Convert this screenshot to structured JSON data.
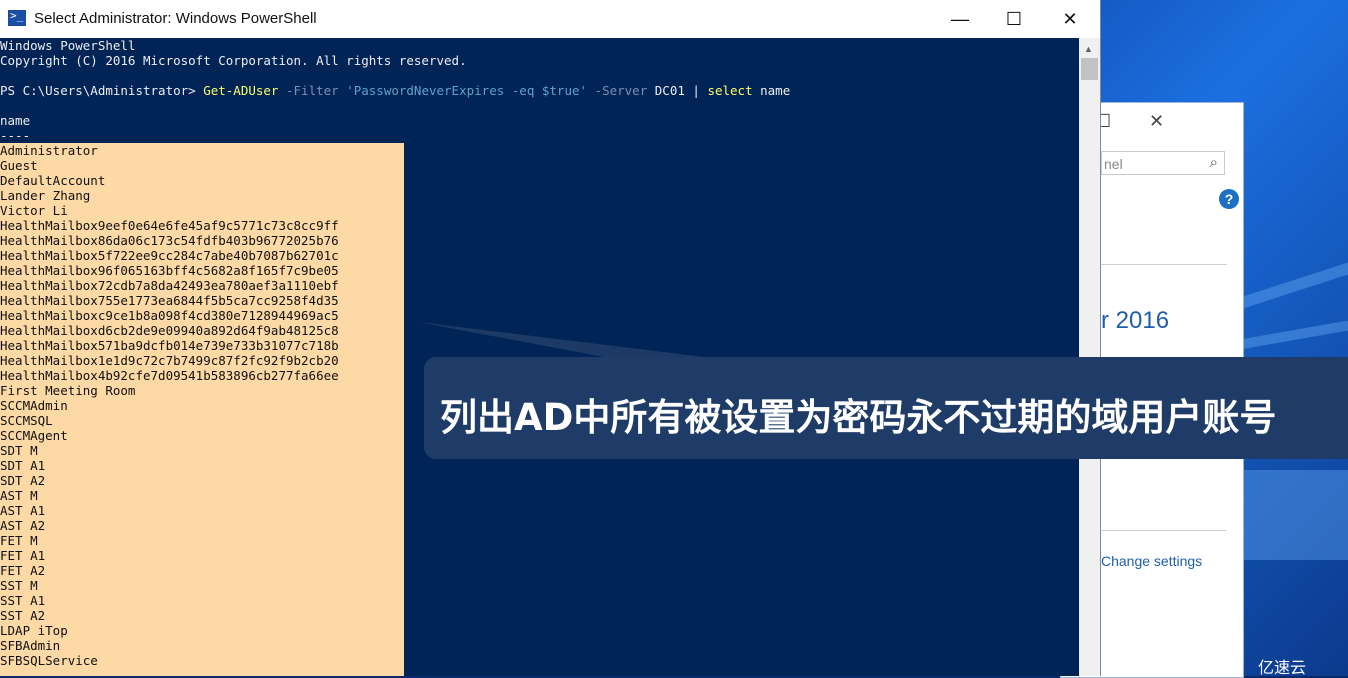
{
  "window": {
    "title": "Select Administrator: Windows PowerShell",
    "controls": [
      "minimize-icon",
      "maximize-icon",
      "close-icon"
    ]
  },
  "console": {
    "header": [
      "Windows PowerShell",
      "Copyright (C) 2016 Microsoft Corporation. All rights reserved."
    ],
    "prompt": "PS C:\\Users\\Administrator> ",
    "command": {
      "cmdlet": "Get-ADUser",
      "param1": " -Filter ",
      "filter": "'PasswordNeverExpires -eq $true'",
      "param2": " -Server ",
      "server": "DC01 | ",
      "select": "select",
      "rest": " name"
    },
    "column_header": "name",
    "column_rule": "----",
    "names": [
      "Administrator",
      "Guest",
      "DefaultAccount",
      "Lander Zhang",
      "Victor Li",
      "HealthMailbox9eef0e64e6fe45af9c5771c73c8cc9ff",
      "HealthMailbox86da06c173c54fdfb403b96772025b76",
      "HealthMailbox5f722ee9cc284c7abe40b7087b62701c",
      "HealthMailbox96f065163bff4c5682a8f165f7c9be05",
      "HealthMailbox72cdb7a8da42493ea780aef3a1110ebf",
      "HealthMailbox755e1773ea6844f5b5ca7cc9258f4d35",
      "HealthMailboxc9ce1b8a098f4cd380e7128944969ac5",
      "HealthMailboxd6cb2de9e09940a892d64f9ab48125c8",
      "HealthMailbox571ba9dcfb014e739e733b31077c718b",
      "HealthMailbox1e1d9c72c7b7499c87f2fc92f9b2cb20",
      "HealthMailbox4b92cfe7d09541b583896cb277fa66ee",
      "First Meeting Room",
      "SCCMAdmin",
      "SCCMSQL",
      "SCCMAgent",
      "SDT M",
      "SDT A1",
      "SDT A2",
      "AST M",
      "AST A1",
      "AST A2",
      "FET M",
      "FET A1",
      "FET A2",
      "SST M",
      "SST A1",
      "SST A2",
      "LDAP iTop",
      "SFBAdmin",
      "SFBSQLService"
    ]
  },
  "background_window": {
    "search_text": "nel",
    "version_text": "r 2016",
    "change_settings": "Change settings"
  },
  "callout": {
    "text": "列出AD中所有被设置为密码永不过期的域用户账号"
  },
  "watermark": "亿速云",
  "colors": {
    "console_bg": "#012456",
    "selection": "#fdd9a6",
    "callout_bg": "#1f3c68"
  }
}
